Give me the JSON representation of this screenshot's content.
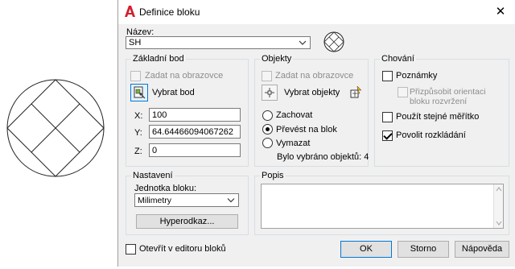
{
  "dialog": {
    "title": "Definice bloku",
    "close_glyph": "✕",
    "icons": {
      "app": "autocad-logo-icon",
      "close": "close-icon"
    }
  },
  "name": {
    "label": "Název:",
    "value": "SH"
  },
  "base_point": {
    "title": "Základní bod",
    "specify_on_screen": "Zadat na obrazovce",
    "pick_point": "Vybrat bod",
    "x_label": "X:",
    "x_value": "100",
    "y_label": "Y:",
    "y_value": "64.64466094067262",
    "z_label": "Z:",
    "z_value": "0"
  },
  "objects": {
    "title": "Objekty",
    "specify_on_screen": "Zadat na obrazovce",
    "select_objects": "Vybrat objekty",
    "retain": "Zachovat",
    "convert": "Převést na blok",
    "delete": "Vymazat",
    "status": "Bylo vybráno objektů: 4",
    "selected_option": "Převést na blok"
  },
  "behavior": {
    "title": "Chování",
    "annotative": "Poznámky",
    "annotative_checked": false,
    "match_orientation": "Přizpůsobit orientaci bloku rozvržení",
    "uniform_scale": "Použít stejné měřítko",
    "uniform_scale_checked": false,
    "allow_exploding": "Povolit rozkládání",
    "allow_exploding_checked": true
  },
  "settings": {
    "title": "Nastavení",
    "unit_label": "Jednotka bloku:",
    "unit_value": "Milimetry",
    "hyperlink": "Hyperodkaz..."
  },
  "description": {
    "title": "Popis",
    "value": ""
  },
  "footer": {
    "open_in_editor": "Otevřít v editoru bloků",
    "open_in_editor_checked": false,
    "ok": "OK",
    "cancel": "Storno",
    "help": "Nápověda"
  },
  "colors": {
    "accent": "#0078d7",
    "logo_red": "#d3202e"
  }
}
